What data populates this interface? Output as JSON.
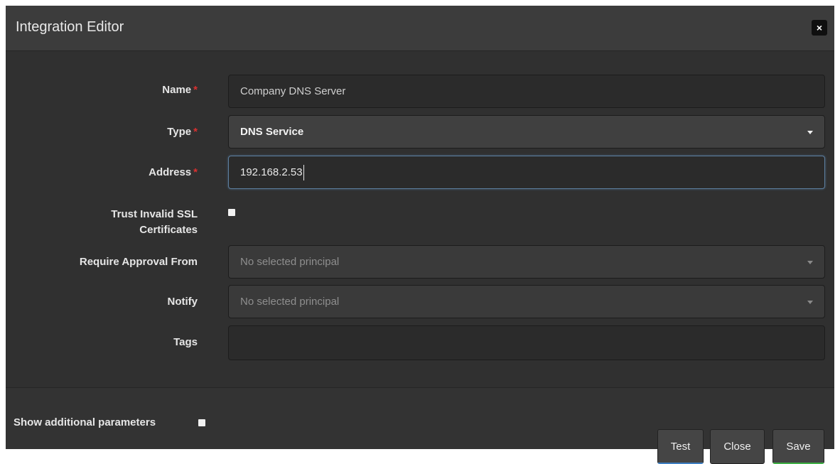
{
  "dialog": {
    "title": "Integration Editor",
    "close_glyph": "×"
  },
  "form": {
    "required_marker": "*",
    "name": {
      "label": "Name",
      "value": "Company DNS Server"
    },
    "type": {
      "label": "Type",
      "value": "DNS Service"
    },
    "address": {
      "label": "Address",
      "value": "192.168.2.53"
    },
    "trust_ssl": {
      "label_line1": "Trust Invalid SSL",
      "label_line2": "Certificates",
      "checked": false
    },
    "require_approval": {
      "label": "Require Approval From",
      "placeholder": "No selected principal"
    },
    "notify": {
      "label": "Notify",
      "placeholder": "No selected principal"
    },
    "tags": {
      "label": "Tags",
      "value": ""
    }
  },
  "footer": {
    "show_additional_label": "Show additional parameters",
    "buttons": {
      "test": "Test",
      "close": "Close",
      "save": "Save"
    }
  },
  "colors": {
    "required": "#d93030",
    "test_accent": "#3d7fc2",
    "save_accent": "#3fb045"
  }
}
